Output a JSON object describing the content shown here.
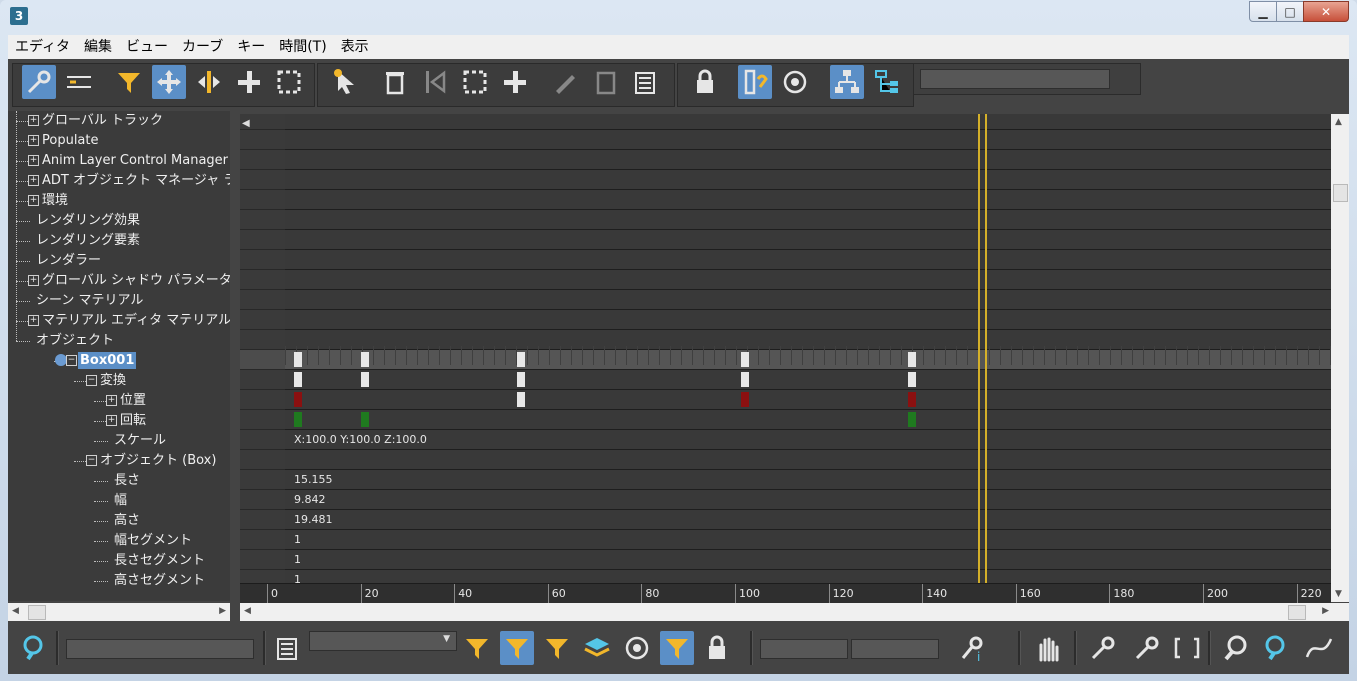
{
  "app": {
    "icon_text": "3"
  },
  "window": {
    "min": "▁",
    "max": "□",
    "close": "✕"
  },
  "menu": [
    "エディタ",
    "編集",
    "ビュー",
    "カーブ",
    "キー",
    "時間(T)",
    "表示"
  ],
  "tree": [
    {
      "label": "グローバル トラック",
      "expand": "+"
    },
    {
      "label": "Populate",
      "expand": "+"
    },
    {
      "label": "Anim Layer Control Manager",
      "expand": "+"
    },
    {
      "label": "ADT オブジェクト マネージャ ラッパ",
      "expand": "+"
    },
    {
      "label": "環境",
      "expand": "+"
    },
    {
      "label": "レンダリング効果",
      "expand": ""
    },
    {
      "label": "レンダリング要素",
      "expand": ""
    },
    {
      "label": "レンダラー",
      "expand": ""
    },
    {
      "label": "グローバル シャドウ パラメータ",
      "expand": "+"
    },
    {
      "label": "シーン マテリアル",
      "expand": ""
    },
    {
      "label": "マテリアル エディタ マテリアル",
      "expand": "+"
    },
    {
      "label": "オブジェクト",
      "expand": ""
    },
    {
      "label": "Box001",
      "expand": "−"
    },
    {
      "label": "変換",
      "expand": "−"
    },
    {
      "label": "位置",
      "expand": "+"
    },
    {
      "label": "回転",
      "expand": "+"
    },
    {
      "label": "スケール",
      "expand": ""
    },
    {
      "label": "オブジェクト (Box)",
      "expand": "−"
    },
    {
      "label": "長さ",
      "expand": ""
    },
    {
      "label": "幅",
      "expand": ""
    },
    {
      "label": "高さ",
      "expand": ""
    },
    {
      "label": "幅セグメント",
      "expand": ""
    },
    {
      "label": "長さセグメント",
      "expand": ""
    },
    {
      "label": "高さセグメント",
      "expand": ""
    }
  ],
  "track_values": {
    "scale": "X:100.0 Y:100.0 Z:100.0",
    "length": "15.155",
    "width": "9.842",
    "height": "19.481",
    "width_segs": "1",
    "length_segs": "1",
    "height_segs": "1"
  },
  "ruler": [
    "0",
    "20",
    "40",
    "60",
    "80",
    "100",
    "120",
    "140",
    "160",
    "180",
    "200",
    "220"
  ],
  "colors": {
    "accent": "#5b8fc7",
    "time_slider": "#d4b02a",
    "key_white": "#e8e8e8",
    "key_red": "#8b1010",
    "key_green": "#1f7a1f"
  },
  "icons": {
    "toolbar": [
      "filter-edit-icon",
      "curve-range-icon",
      "filter-icon",
      "move-keys-icon",
      "slide-keys-icon",
      "add-keys-icon",
      "scale-keys-icon",
      "select-time-icon",
      "delete-time-icon",
      "reverse-time-icon",
      "scale-time-icon",
      "insert-time-icon",
      "edit-ranges-icon",
      "position-ranges-icon",
      "recreate-ranges-icon",
      "lock-selection-icon",
      "snap-frames-icon",
      "show-keyable-icon",
      "hierarchy-mode-icon",
      "track-view-icon"
    ],
    "statusbar": [
      "zoom-selected-icon",
      "edit-track-icon",
      "filter-selected-tracks-icon",
      "filter-selected-objects-icon",
      "filter-animated-icon",
      "filter-layers-icon",
      "filter-visible-icon",
      "filter-keyable-icon",
      "filter-unlocked-icon",
      "key-info-icon",
      "pan-icon",
      "frame-horizontal-icon",
      "frame-values-icon",
      "bracket-icon",
      "zoom-icon",
      "zoom-region-icon",
      "isolate-curve-icon"
    ]
  }
}
